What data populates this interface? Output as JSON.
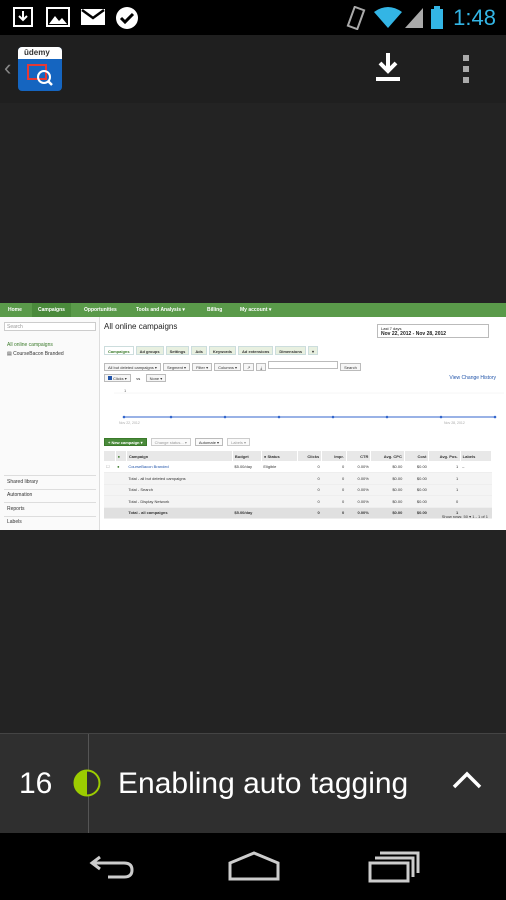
{
  "status_bar": {
    "time": "1:48",
    "icons": [
      "download-icon",
      "image-icon",
      "gmail-icon",
      "check-icon",
      "vibrate-icon",
      "wifi-icon",
      "battery-icon"
    ]
  },
  "action_bar": {
    "app_logo_text": "ûdemy",
    "actions": [
      "download-icon",
      "overflow-menu-icon"
    ]
  },
  "adwords": {
    "nav": [
      "Home",
      "Campaigns",
      "Opportunities",
      "Tools and Analysis ▾",
      "Billing",
      "My account ▾"
    ],
    "nav_active": "Campaigns",
    "sidebar": {
      "search_placeholder": "Search",
      "all_campaigns": "All online campaigns",
      "campaign": "CourseBacon Branded",
      "shared_library": "Shared library",
      "automation": "Automation",
      "reports": "Reports",
      "labels": "Labels"
    },
    "title": "All online campaigns",
    "date_range_label": "Last 7 days",
    "date_range": "Nov 22, 2012 - Nov 28, 2012",
    "tabs": [
      "Campaigns",
      "Ad groups",
      "Settings",
      "Ads",
      "Keywords",
      "Ad extensions",
      "Dimensions",
      "▾"
    ],
    "controls": [
      "All but deleted campaigns ▾",
      "Segment ▾",
      "Filter ▾",
      "Columns ▾",
      "↗",
      "⤓"
    ],
    "search_button": "Search",
    "metric": "Clicks ▾",
    "vs": "vs",
    "metric2": "None ▾",
    "view_change_history": "View Change History",
    "chart_start": "Nov 22, 2012",
    "chart_end": "Nov 28, 2012",
    "chart_y": "1",
    "actions": [
      "+ New campaign ▾",
      "Change status... ▾",
      "Automate ▾",
      "Labels ▾"
    ],
    "table_headers": [
      "",
      "●",
      "Campaign",
      "Budget",
      "● Status",
      "Clicks",
      "Impr.",
      "CTR",
      "Avg. CPC",
      "Cost",
      "Avg. Pos.",
      "Labels"
    ],
    "rows": [
      {
        "name": "CourseBacon Branded",
        "budget": "$5.00/day",
        "status": "Eligible",
        "clicks": "0",
        "impr": "0",
        "ctr": "0.00%",
        "cpc": "$0.00",
        "cost": "$0.00",
        "pos": "1",
        "labels": "–",
        "type": "campaign"
      },
      {
        "name": "Total - all but deleted campaigns",
        "budget": "",
        "status": "",
        "clicks": "0",
        "impr": "0",
        "ctr": "0.00%",
        "cpc": "$0.00",
        "cost": "$0.00",
        "pos": "1",
        "labels": "",
        "type": "total"
      },
      {
        "name": "Total - Search",
        "budget": "",
        "status": "",
        "clicks": "0",
        "impr": "0",
        "ctr": "0.00%",
        "cpc": "$0.00",
        "cost": "$0.00",
        "pos": "1",
        "labels": "",
        "type": "total"
      },
      {
        "name": "Total - Display Network",
        "budget": "",
        "status": "",
        "clicks": "0",
        "impr": "0",
        "ctr": "0.00%",
        "cpc": "$0.00",
        "cost": "$0.00",
        "pos": "0",
        "labels": "",
        "type": "total"
      },
      {
        "name": "Total - all campaigns",
        "budget": "$5.00/day",
        "status": "",
        "clicks": "0",
        "impr": "0",
        "ctr": "0.00%",
        "cpc": "$0.00",
        "cost": "$0.00",
        "pos": "1",
        "labels": "",
        "type": "grand"
      }
    ],
    "pager": "Show rows: 50 ▾  1 - 1 of 1"
  },
  "lesson": {
    "number": "16",
    "title": "Enabling auto tagging",
    "progress": 0.5
  },
  "colors": {
    "status_time": "#33b5e5",
    "progress": "#9ccc00",
    "adwords_green": "#5a9a4a"
  }
}
